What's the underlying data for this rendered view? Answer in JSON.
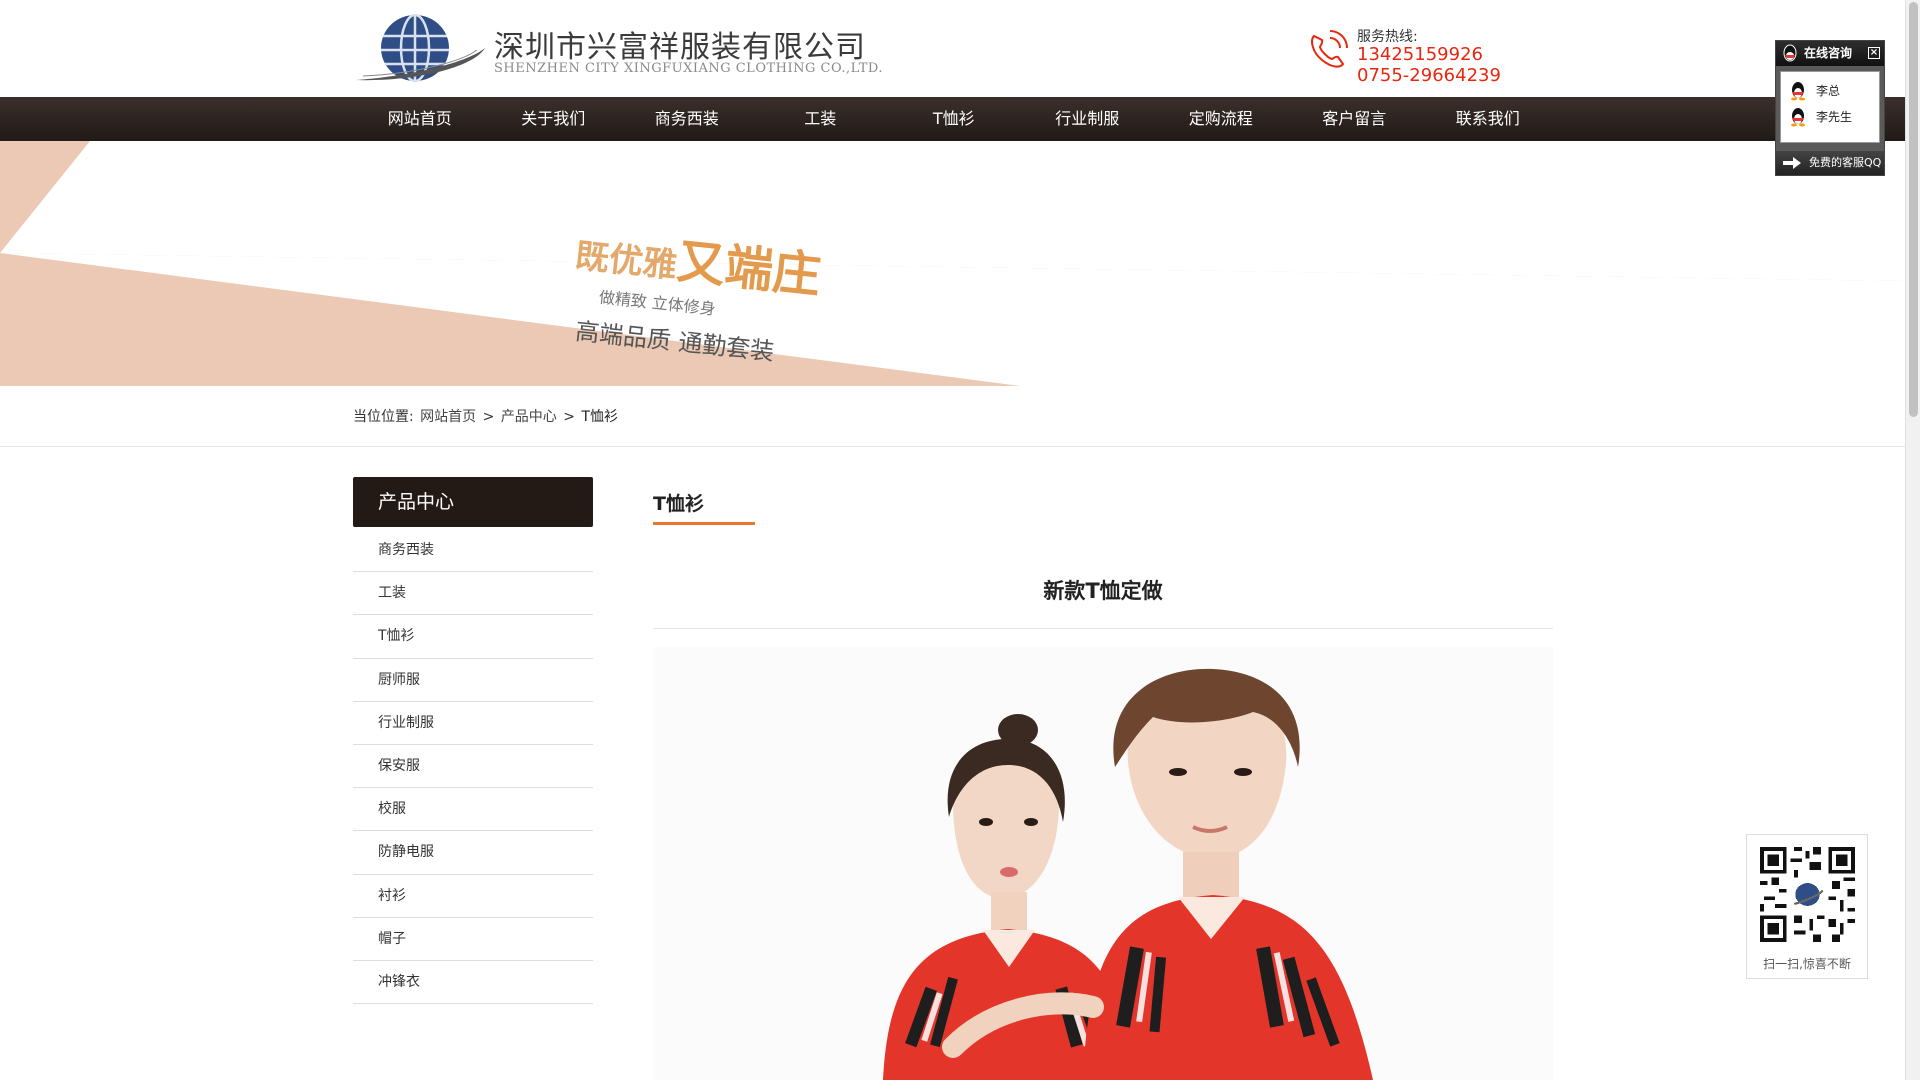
{
  "header": {
    "company_cn": "深圳市兴富祥服装有限公司",
    "company_en": "SHENZHEN CITY XINGFUXIANG CLOTHING CO.,LTD.",
    "hotline_label": "服务热线:",
    "hotline_phone_1": "13425159926",
    "hotline_phone_2": "0755-29664239"
  },
  "nav": {
    "items": [
      "网站首页",
      "关于我们",
      "商务西装",
      "工装",
      "T恤衫",
      "行业制服",
      "定购流程",
      "客户留言",
      "联系我们"
    ]
  },
  "banner": {
    "slogan_part1": "既优雅",
    "slogan_part2": "又端庄",
    "slogan_sub": "做精致  立体修身",
    "slogan_main": "高端品质  通勤套装"
  },
  "breadcrumb": {
    "label": "当位位置:",
    "home": "网站首页",
    "sep": ">",
    "section": "产品中心",
    "current": "T恤衫"
  },
  "sidebar": {
    "title": "产品中心",
    "items": [
      "商务西装",
      "工装",
      "T恤衫",
      "厨师服",
      "行业制服",
      "保安服",
      "校服",
      "防静电服",
      "衬衫",
      "帽子",
      "冲锋衣"
    ]
  },
  "main": {
    "title": "T恤衫",
    "product_name": "新款T恤定做"
  },
  "qq_widget": {
    "title": "在线咨询",
    "close": "×",
    "contacts": [
      "李总",
      "李先生"
    ],
    "footer": "免费的客服QQ"
  },
  "qr": {
    "caption": "扫一扫,惊喜不断"
  },
  "colors": {
    "nav_bg": "#231a16",
    "accent_orange": "#e8762b",
    "hotline_red": "#e8270f",
    "banner_peach": "#ecc9b4"
  }
}
